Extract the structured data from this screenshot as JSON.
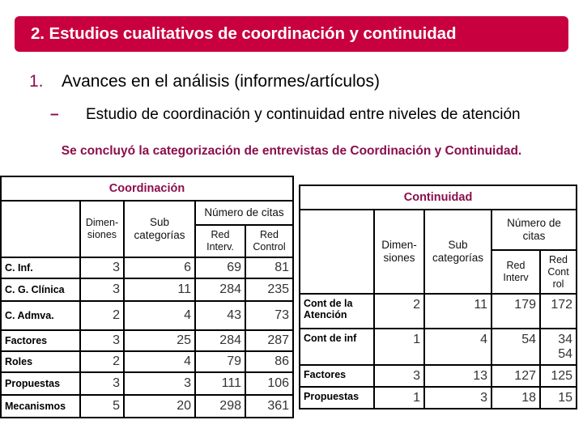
{
  "slide": {
    "title": "2. Estudios cualitativos de coordinación y continuidad",
    "list_number": "1.",
    "list_item": "Avances en el análisis (informes/artículos)",
    "sub_bullet": "–",
    "sub_item": "Estudio de coordinación y continuidad entre niveles de atención",
    "conclusion": "Se concluyó la categorización de entrevistas de Coordinación y Continuidad.",
    "colors": {
      "title_bar": "#c8003f",
      "accent_text": "#8b0f4c"
    }
  },
  "coordinacion": {
    "title": "Coordinación",
    "headers": {
      "dimensiones": "Dimen-\nsiones",
      "subcategorias": "Sub\ncategorías",
      "numero_citas": "Número de citas",
      "red_interv": "Red\nInterv.",
      "red_control": "Red\nControl"
    },
    "rows": [
      {
        "label": "C. Inf.",
        "dimensiones": "3",
        "subcategorias": "6",
        "red_interv": "69",
        "red_control": "81"
      },
      {
        "label": "C. G. Clínica",
        "dimensiones": "3",
        "subcategorias": "11",
        "red_interv": "284",
        "red_control": "235"
      },
      {
        "label": "C. Admva.",
        "dimensiones": "2",
        "subcategorias": "4",
        "red_interv": "43",
        "red_control": "73"
      },
      {
        "label": "Factores",
        "dimensiones": "3",
        "subcategorias": "25",
        "red_interv": "284",
        "red_control": "287"
      },
      {
        "label": "Roles",
        "dimensiones": "2",
        "subcategorias": "4",
        "red_interv": "79",
        "red_control": "86"
      },
      {
        "label": "Propuestas",
        "dimensiones": "3",
        "subcategorias": "3",
        "red_interv": "111",
        "red_control": "106"
      },
      {
        "label": "Mecanismos",
        "dimensiones": "5",
        "subcategorias": "20",
        "red_interv": "298",
        "red_control": "361"
      }
    ]
  },
  "continuidad": {
    "title": "Continuidad",
    "headers": {
      "dimensiones": "Dimen-\nsiones",
      "subcategorias": "Sub\ncategorías",
      "numero_citas": "Número de\ncitas",
      "red_interv": "Red\nInterv",
      "red_control": "Red\nCont\nrol"
    },
    "rows": [
      {
        "label": "Cont de la\nAtención",
        "dimensiones": "2",
        "subcategorias": "11",
        "red_interv": "179",
        "red_control": "172"
      },
      {
        "label": "Cont de inf",
        "dimensiones": "1",
        "subcategorias": "4",
        "red_interv": "54",
        "red_control": "34\n54"
      },
      {
        "label": "Factores",
        "dimensiones": "3",
        "subcategorias": "13",
        "red_interv": "127",
        "red_control": "125"
      },
      {
        "label": "Propuestas",
        "dimensiones": "1",
        "subcategorias": "3",
        "red_interv": "18",
        "red_control": "15"
      }
    ]
  }
}
